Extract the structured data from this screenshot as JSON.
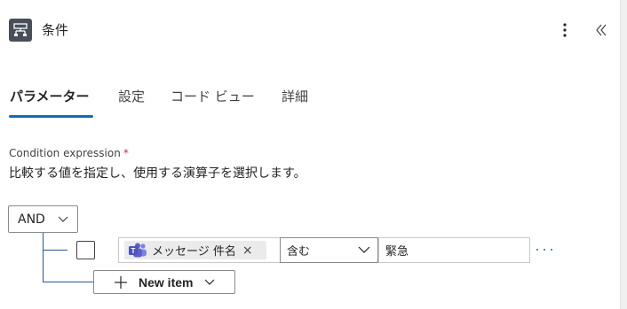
{
  "header": {
    "title": "条件",
    "action_icon": "condition-icon",
    "more_icon": "more-vertical-icon",
    "collapse_icon": "double-chevron-left-icon"
  },
  "tabs": [
    {
      "label": "パラメーター",
      "active": true
    },
    {
      "label": "設定",
      "active": false
    },
    {
      "label": "コード ビュー",
      "active": false
    },
    {
      "label": "詳細",
      "active": false
    }
  ],
  "condition": {
    "label": "Condition expression",
    "required_mark": "*",
    "description": "比較する値を指定し、使用する演算子を選択します。",
    "group_operator": "AND",
    "rows": [
      {
        "token_label": "メッセージ 件名",
        "token_icon": "teams-icon",
        "token_remove": "×",
        "operator": "含む",
        "value": "緊急"
      }
    ],
    "new_item_label": "New item"
  },
  "colors": {
    "accent": "#0f6cbd",
    "tree_line": "#2b5797",
    "required": "#c4314b",
    "teams_purple": "#5b5fc7"
  }
}
